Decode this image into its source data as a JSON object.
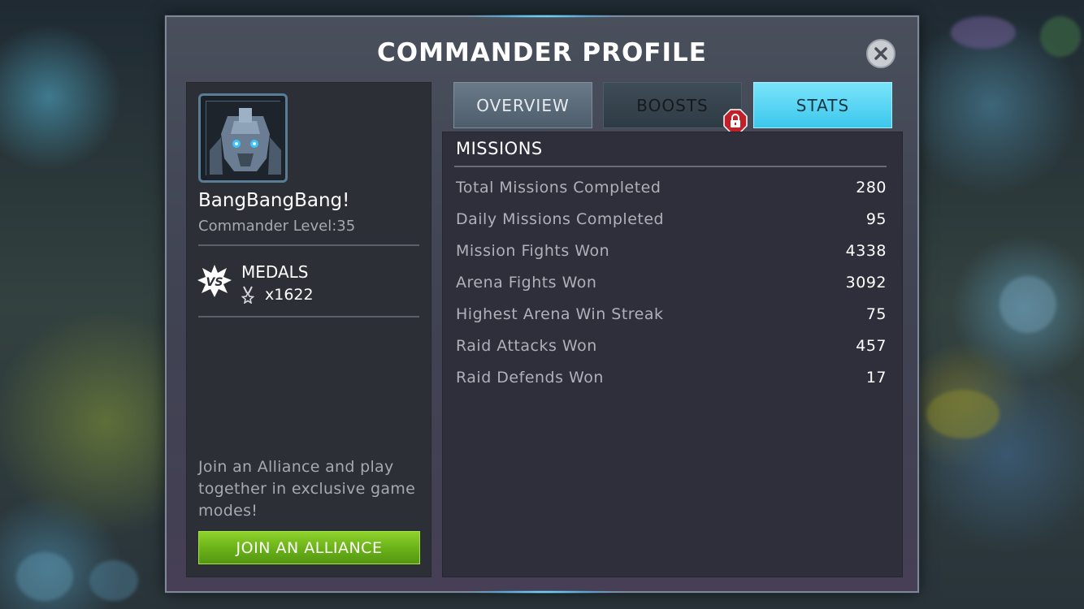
{
  "title": "COMMANDER PROFILE",
  "profile": {
    "name": "BangBangBang!",
    "level_text": "Commander Level:35",
    "medals_label": "MEDALS",
    "medals_count": "x1622"
  },
  "alliance": {
    "promo_text": "Join an Alliance and play together in exclusive game modes!",
    "button_label": "JOIN AN ALLIANCE"
  },
  "tabs": [
    {
      "label": "OVERVIEW",
      "active": false,
      "locked": false
    },
    {
      "label": "BOOSTS",
      "active": false,
      "locked": true
    },
    {
      "label": "STATS",
      "active": true,
      "locked": false
    }
  ],
  "stats": {
    "section_title": "MISSIONS",
    "rows": [
      {
        "label": "Total Missions Completed",
        "value": "280"
      },
      {
        "label": "Daily Missions Completed",
        "value": "95"
      },
      {
        "label": "Mission Fights Won",
        "value": "4338"
      },
      {
        "label": "Arena Fights Won",
        "value": "3092"
      },
      {
        "label": "Highest Arena Win Streak",
        "value": "75"
      },
      {
        "label": "Raid Attacks Won",
        "value": "457"
      },
      {
        "label": "Raid Defends Won",
        "value": "17"
      }
    ]
  },
  "icons": {
    "close": "close-icon",
    "lock": "lock-icon",
    "medals": "vs-medal-icon",
    "medal_small": "medal-icon",
    "avatar": "robot-avatar"
  },
  "colors": {
    "active_tab": "#3cc7ec",
    "join_button": "#69b018",
    "lock_badge": "#c0202a"
  }
}
